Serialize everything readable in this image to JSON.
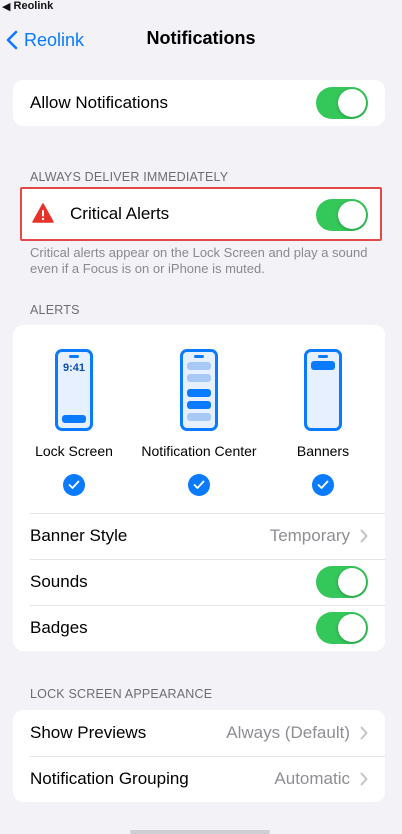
{
  "status": {
    "back_app": "Reolink"
  },
  "nav": {
    "back_label": "Reolink",
    "title": "Notifications"
  },
  "allow": {
    "label": "Allow Notifications",
    "on": true
  },
  "critical_section": {
    "header": "ALWAYS DELIVER IMMEDIATELY",
    "label": "Critical Alerts",
    "footnote": "Critical alerts appear on the Lock Screen and play a sound even if a Focus is on or iPhone is muted."
  },
  "alerts": {
    "header": "ALERTS",
    "types": [
      {
        "label": "Lock Screen",
        "time": "9:41"
      },
      {
        "label": "Notification Center"
      },
      {
        "label": "Banners"
      }
    ],
    "banner_style": {
      "label": "Banner Style",
      "value": "Temporary"
    },
    "sounds": {
      "label": "Sounds"
    },
    "badges": {
      "label": "Badges"
    }
  },
  "lock_screen": {
    "header": "LOCK SCREEN APPEARANCE",
    "show_previews": {
      "label": "Show Previews",
      "value": "Always (Default)"
    },
    "grouping": {
      "label": "Notification Grouping",
      "value": "Automatic"
    }
  },
  "colors": {
    "accent": "#0a7aff",
    "toggle_on": "#34c759",
    "highlight": "#e24a4a"
  }
}
